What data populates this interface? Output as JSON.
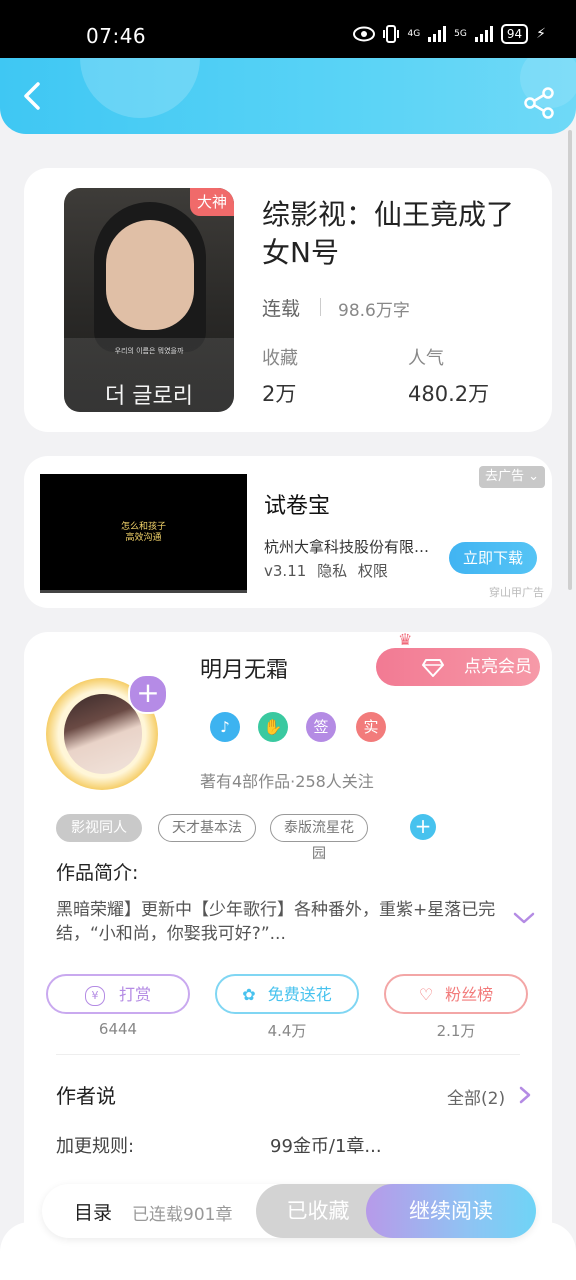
{
  "status_bar": {
    "time": "07:46",
    "battery": "94",
    "network_a": "4G",
    "network_b": "5G"
  },
  "book": {
    "badge": "大神",
    "title": "综影视：仙王竟成了女N号",
    "status": "连载",
    "word_count": "98.6万字",
    "collect_label": "收藏",
    "collect_value": "2万",
    "popularity_label": "人气",
    "popularity_value": "480.2万",
    "cover": {
      "title_text": "더 글로리",
      "subtitle_text": "우리의 이름은 뭐였을까"
    }
  },
  "ad": {
    "close_label": "去广告 ⌄",
    "video_text": "怎么和孩子\n高效沟通",
    "app_name": "试卷宝",
    "company": "杭州大拿科技股份有限公司",
    "version": "v3.11",
    "privacy": "隐私",
    "permissions": "权限",
    "download_label": "立即下载",
    "source": "穿山甲广告"
  },
  "author": {
    "name": "明月无霜",
    "vip_label": "点亮会员",
    "medals": [
      {
        "icon": "music-note-icon",
        "text": "♪",
        "color": "#3db3f0"
      },
      {
        "icon": "handshake-icon",
        "text": "✋",
        "color": "#3ac9a0"
      },
      {
        "icon": "sign-icon",
        "text": "签",
        "color": "#b48be4"
      },
      {
        "icon": "real-name-icon",
        "text": "实",
        "color": "#f27b7b"
      }
    ],
    "stats": "著有4部作品·258人关注",
    "tags": [
      "影视同人",
      "天才基本法",
      "泰版流星花园"
    ],
    "intro_label": "作品简介:",
    "intro_text": "黑暗荣耀】更新中【少年歌行】各种番外，重紫+星落已完结，“小和尚，你娶我可好?”...",
    "actions": [
      {
        "label": "打赏",
        "count": "6444",
        "color": "#b48be4"
      },
      {
        "label": "免费送花",
        "count": "4.4万",
        "color": "#47c2ee"
      },
      {
        "label": "粉丝榜",
        "count": "2.1万",
        "color": "#f27b7b"
      }
    ],
    "says_title": "作者说",
    "says_all": "全部(2)",
    "rule_label": "加更规则:",
    "rule_value": "99金币/1章..."
  },
  "bottom": {
    "toc_label": "目录",
    "chapter_count": "已连载901章",
    "collected_label": "已收藏",
    "continue_label": "继续阅读"
  }
}
